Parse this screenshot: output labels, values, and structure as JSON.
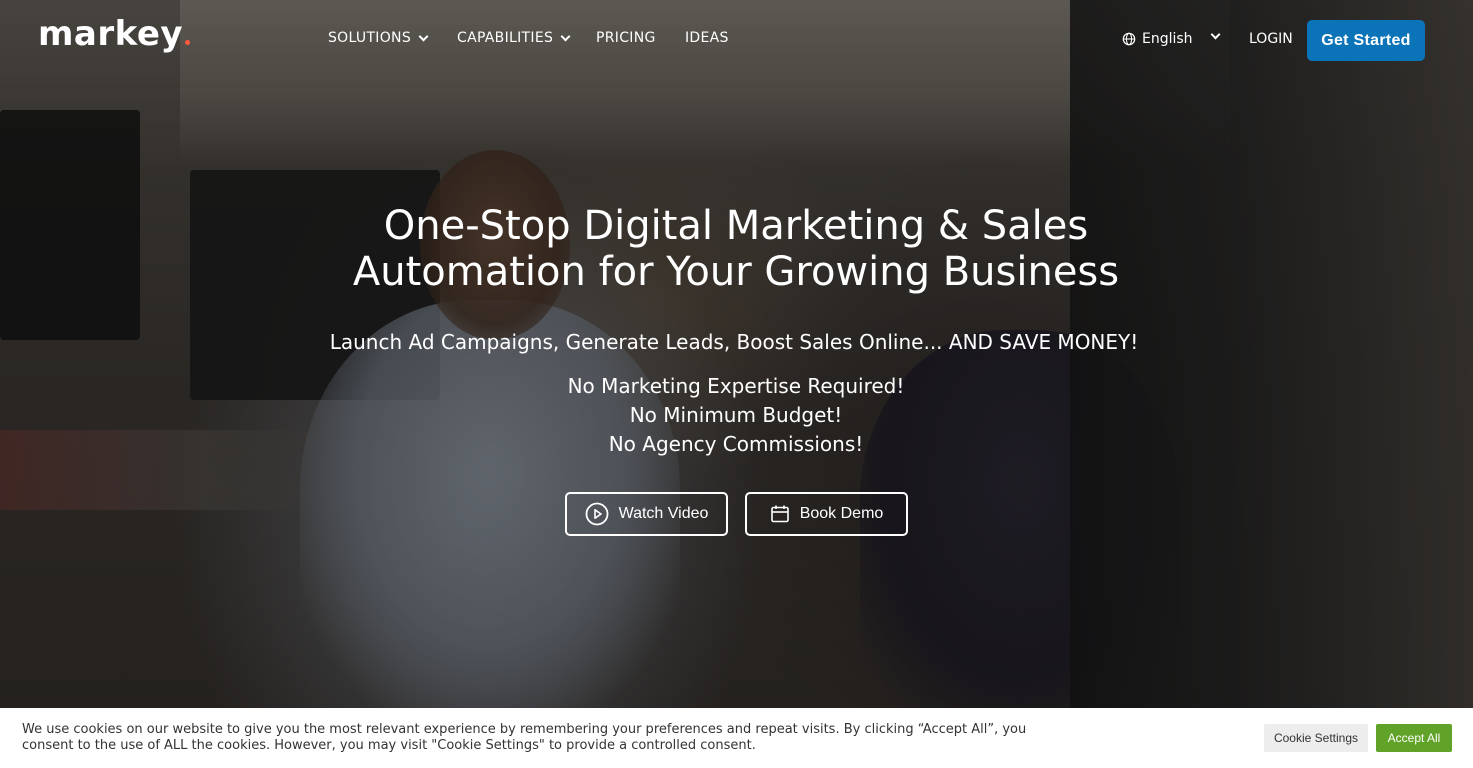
{
  "header": {
    "logo": "markey",
    "nav": [
      {
        "label": "SOLUTIONS",
        "has_dropdown": true
      },
      {
        "label": "CAPABILITIES",
        "has_dropdown": true
      },
      {
        "label": "PRICING",
        "has_dropdown": false
      },
      {
        "label": "IDEAS",
        "has_dropdown": false
      }
    ],
    "language": "English",
    "login": "LOGIN",
    "cta": "Get Started"
  },
  "hero": {
    "title_line1": "One-Stop Digital Marketing & Sales",
    "title_line2": "Automation for Your Growing Business",
    "subtitle": "Launch Ad Campaigns, Generate Leads, Boost Sales Online... AND SAVE MONEY!",
    "points": [
      "No Marketing Expertise Required!",
      "No Minimum Budget!",
      "No Agency Commissions!"
    ],
    "watch_video": "Watch Video",
    "book_demo": "Book Demo"
  },
  "cookie": {
    "text": "We use cookies on our website to give you the most relevant experience by remembering your preferences and repeat visits. By clicking “Accept All”, you consent to the use of ALL the cookies. However, you may visit \"Cookie Settings\" to provide a controlled consent.",
    "settings_label": "Cookie Settings",
    "accept_label": "Accept All"
  },
  "colors": {
    "cta_blue": "#0b74b8",
    "accept_green": "#61a229",
    "logo_dot": "#ff5a3c"
  },
  "icons": [
    "globe-icon",
    "chevron-down-icon",
    "play-circle-icon",
    "calendar-icon"
  ]
}
